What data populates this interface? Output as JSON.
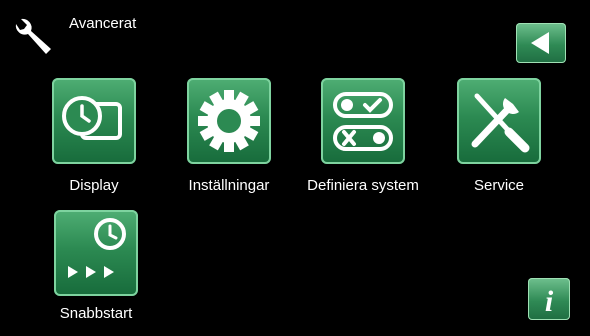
{
  "header": {
    "title": "Avancerat",
    "icon": "wrench-icon"
  },
  "nav": {
    "back_icon": "back-arrow-icon",
    "info_label": "i"
  },
  "menu": [
    {
      "label": "Display",
      "icon": "display-clock-icon"
    },
    {
      "label": "Inställningar",
      "icon": "gear-icon"
    },
    {
      "label": "Definiera system",
      "icon": "toggle-switches-icon"
    },
    {
      "label": "Service",
      "icon": "tools-icon"
    },
    {
      "label": "Snabbstart",
      "icon": "clock-fast-forward-icon"
    }
  ],
  "colors": {
    "background": "#000000",
    "accent": "#2c8a52",
    "text": "#ffffff"
  }
}
